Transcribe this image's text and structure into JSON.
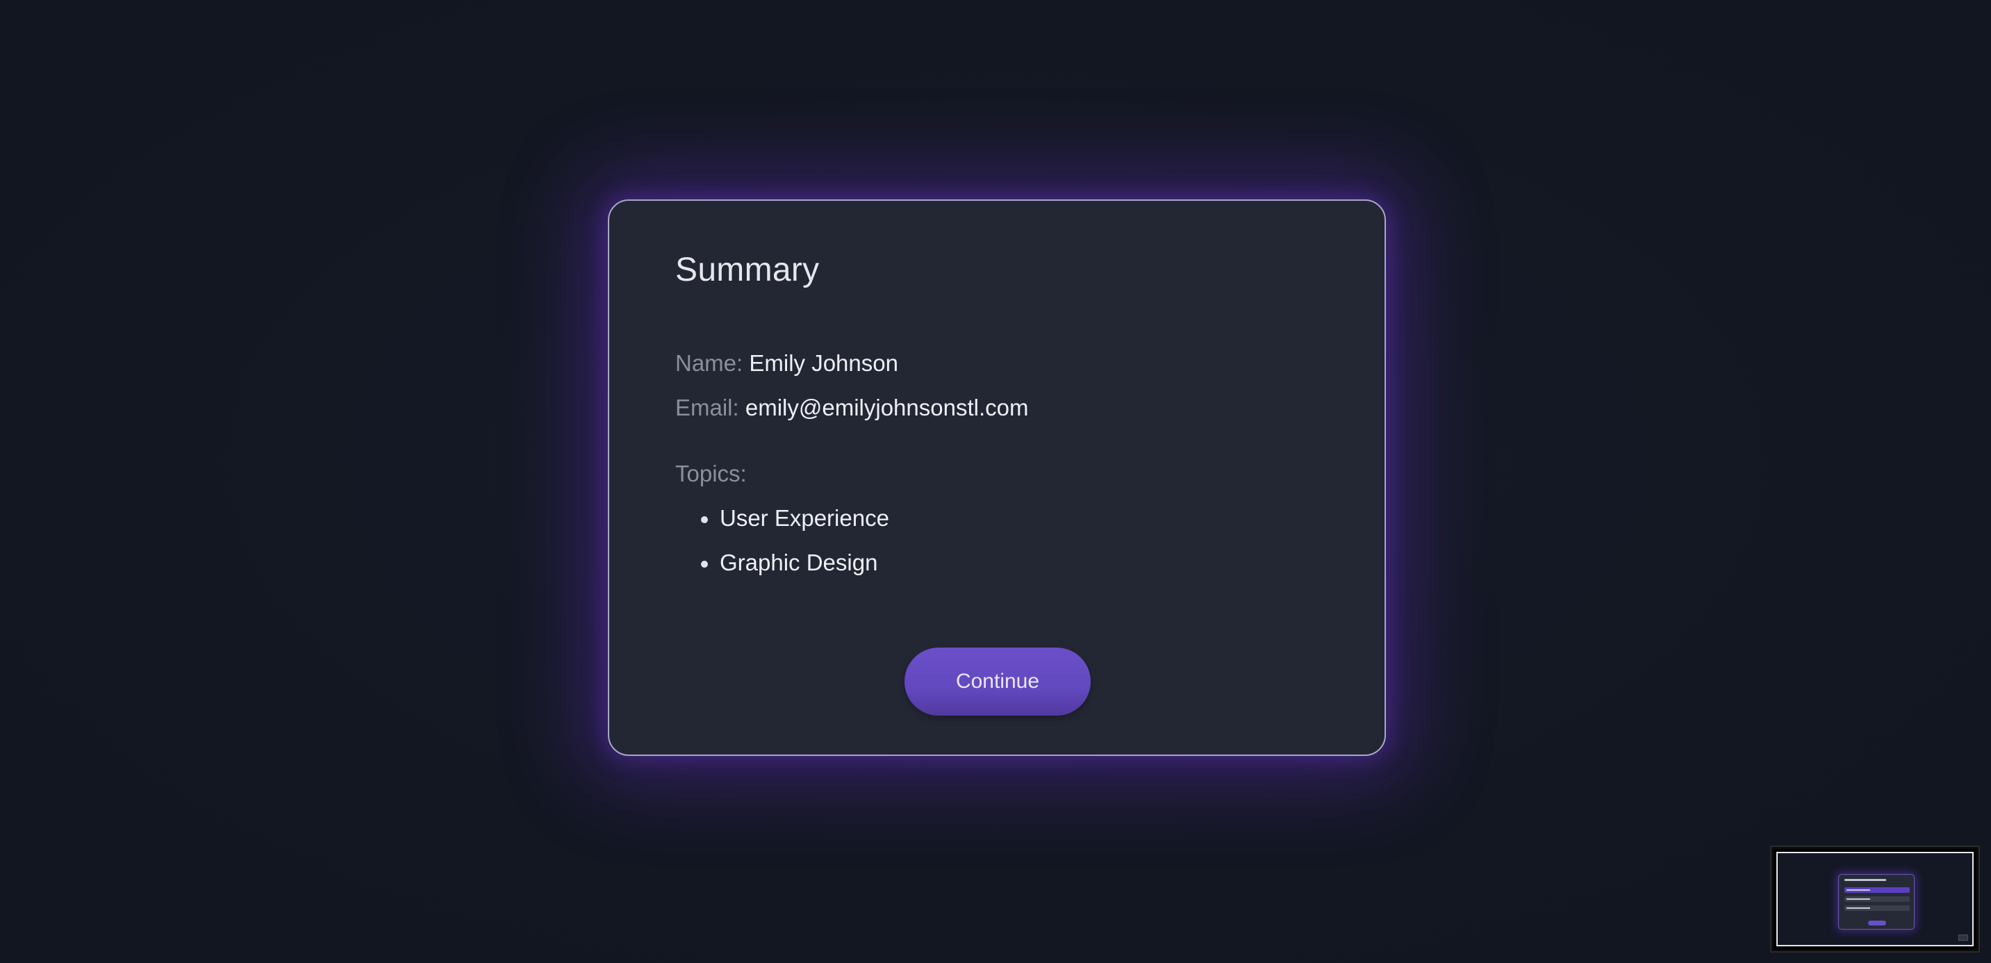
{
  "summary": {
    "title": "Summary",
    "name_label": "Name:",
    "name_value": "Emily Johnson",
    "email_label": "Email:",
    "email_value": "emily@emilyjohnsonstl.com",
    "topics_label": "Topics:",
    "topics": [
      "User Experience",
      "Graphic Design"
    ]
  },
  "actions": {
    "continue_label": "Continue"
  },
  "colors": {
    "background": "#131722",
    "card": "#232734",
    "accent": "#6b4fc9",
    "glow": "#5e2dbe"
  },
  "icons": {
    "minimap": "minimap-preview"
  }
}
